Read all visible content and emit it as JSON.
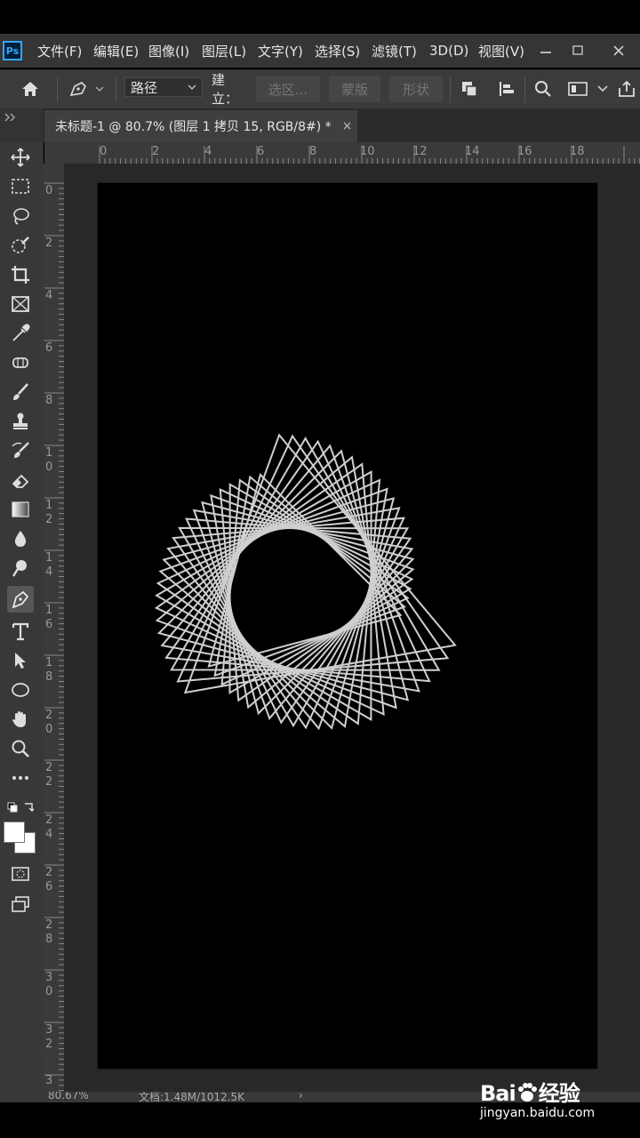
{
  "app": {
    "logo": "Ps"
  },
  "menu": [
    "文件(F)",
    "编辑(E)",
    "图像(I)",
    "图层(L)",
    "文字(Y)",
    "选择(S)",
    "滤镜(T)",
    "3D(D)",
    "视图(V)"
  ],
  "options": {
    "mode_value": "路径",
    "build_label": "建立：",
    "selection_button": "选区...",
    "mask_button": "蒙版",
    "shape_button": "形状"
  },
  "document": {
    "tab_title": "未标题-1 @ 80.7% (图层 1 拷贝 15, RGB/8#) *",
    "close_glyph": "×"
  },
  "ruler": {
    "top_labels": [
      "0",
      "2",
      "4",
      "6",
      "8",
      "10",
      "12",
      "14",
      "16",
      "18"
    ],
    "left_labels": [
      "0",
      "2",
      "4",
      "6",
      "8",
      "10",
      "12",
      "14",
      "16",
      "18",
      "20",
      "22",
      "24",
      "26",
      "28",
      "30",
      "32",
      "3"
    ]
  },
  "status": {
    "zoom": "80.67%",
    "doc_info": "文档:1.48M/1012.5K",
    "arrow": "›"
  },
  "watermark": {
    "logo_left": "Bai",
    "logo_right": "经验",
    "url": "jingyan.baidu.com"
  },
  "artwork": {
    "shape": "rotated triangles",
    "stroke_color": "#cfcfcf",
    "count": 24
  },
  "colors": {
    "foreground": "#ffffff",
    "background": "#ffffff",
    "panel": "#383838",
    "canvas": "#000000"
  }
}
